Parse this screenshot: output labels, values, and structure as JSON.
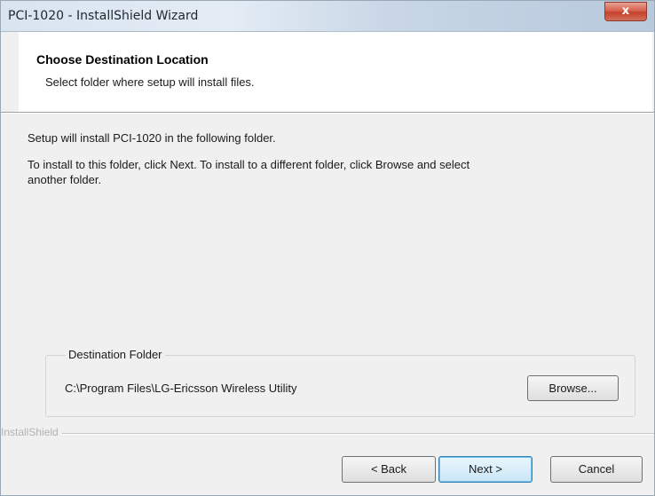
{
  "window": {
    "title": "PCI-1020 - InstallShield Wizard",
    "close_glyph": "x"
  },
  "header": {
    "title": "Choose Destination Location",
    "subtitle": "Select folder where setup will install files."
  },
  "body": {
    "line1": "Setup will install PCI-1020 in the following folder.",
    "line2": "To install to this folder, click Next. To install to a different folder, click Browse and select",
    "line3": "another folder."
  },
  "destination": {
    "label": "Destination Folder",
    "path": "C:\\Program Files\\LG-Ericsson Wireless Utility",
    "browse_label": "Browse..."
  },
  "footer": {
    "brand": "InstallShield",
    "back_label": "< Back",
    "next_label": "Next >",
    "cancel_label": "Cancel"
  },
  "colors": {
    "close_button": "#c4412b",
    "default_button_border": "#3c7fb1"
  }
}
